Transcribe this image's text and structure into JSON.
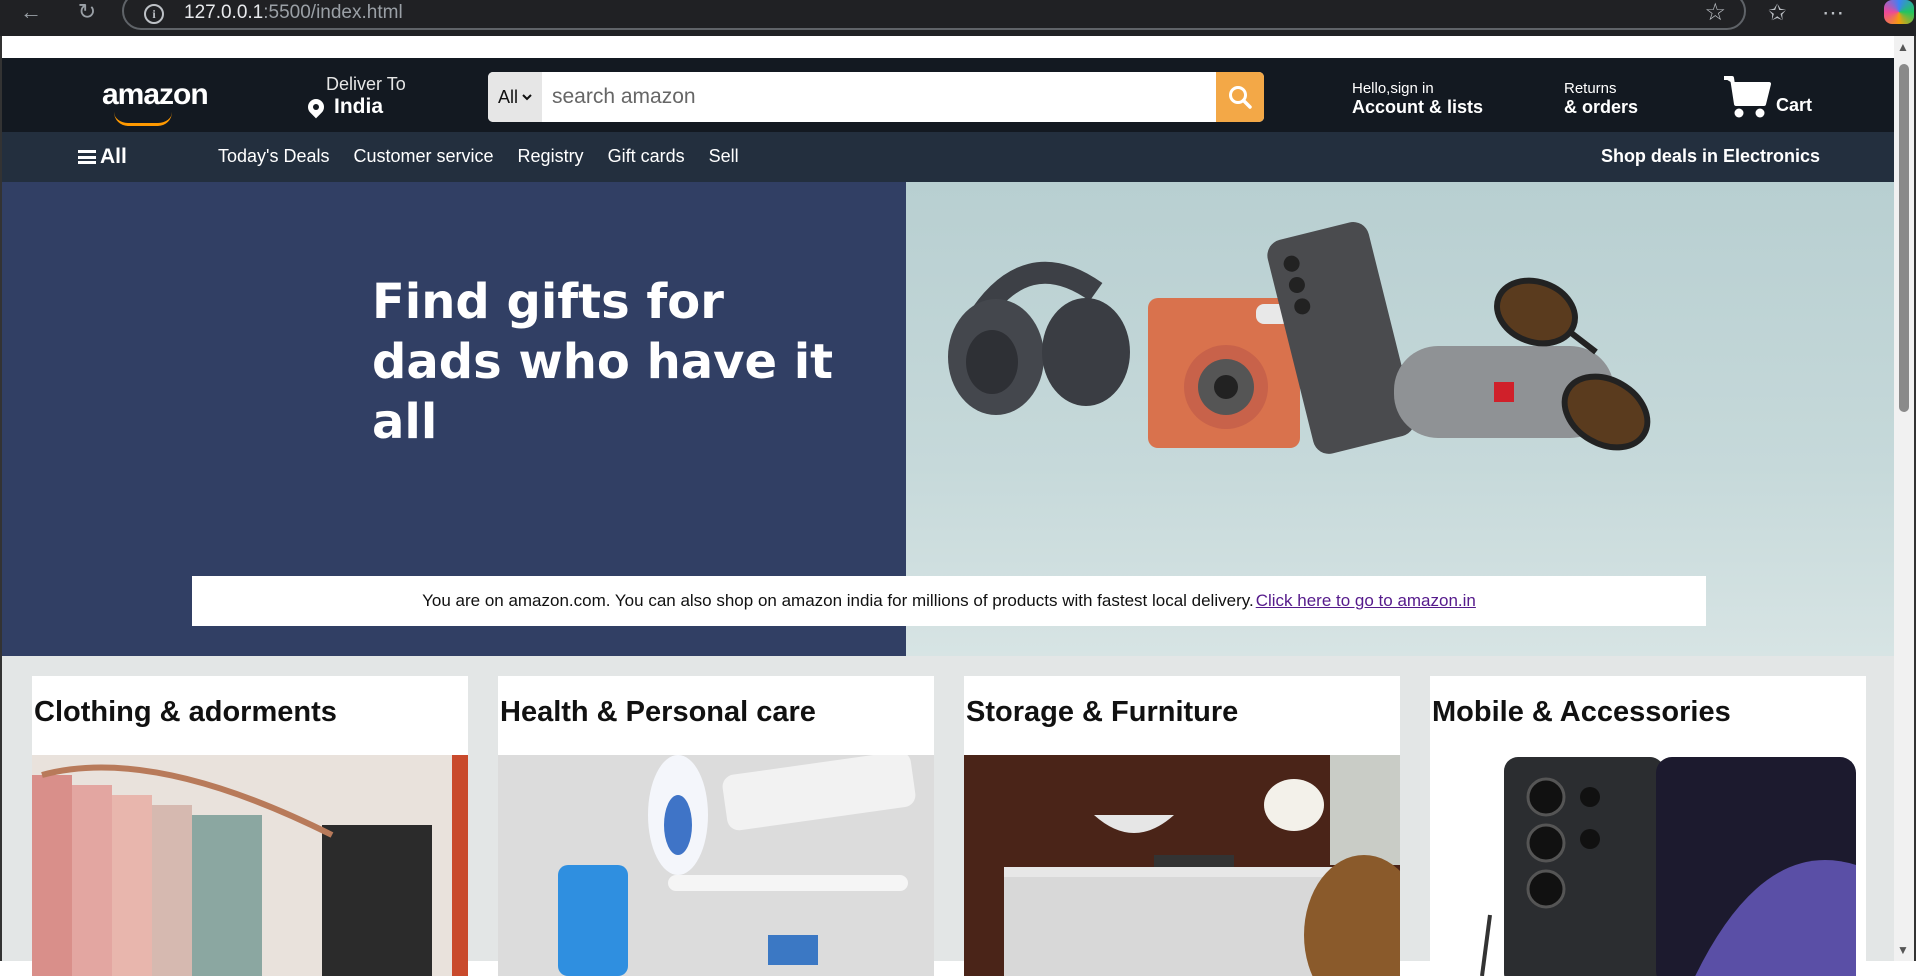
{
  "browser": {
    "url_host": "127.0.0.1",
    "url_rest": ":5500/index.html",
    "back_icon": "arrow-left-icon",
    "reload_icon": "reload-icon"
  },
  "header": {
    "logo": "amazon",
    "deliver_small": "Deliver To",
    "deliver_country": "India",
    "search_category": "All",
    "search_placeholder": "search amazon",
    "account_small": "Hello,sign in",
    "account_big": "Account & lists",
    "returns_small": "Returns",
    "returns_big": "& orders",
    "cart_label": "Cart"
  },
  "subnav": {
    "all_label": "All",
    "links": [
      "Today's Deals",
      "Customer service",
      "Registry",
      "Gift cards",
      "Sell"
    ],
    "promo": "Shop deals in Electronics"
  },
  "hero": {
    "line1": "Find gifts for",
    "line2": "dads who have it all",
    "notice_text": "You are on amazon.com. You can also shop on amazon india for millions of products with fastest local delivery.",
    "notice_link": "Click here to go to amazon.in"
  },
  "products": [
    {
      "title": "Clothing & adorments"
    },
    {
      "title": "Health & Personal care"
    },
    {
      "title": "Storage & Furniture"
    },
    {
      "title": "Mobile & Accessories"
    }
  ],
  "colors": {
    "header_bg": "#131921",
    "subnav_bg": "#232f3e",
    "search_button": "#f3a847",
    "hero_left": "#313f64",
    "products_bg": "#e3e6e6"
  }
}
